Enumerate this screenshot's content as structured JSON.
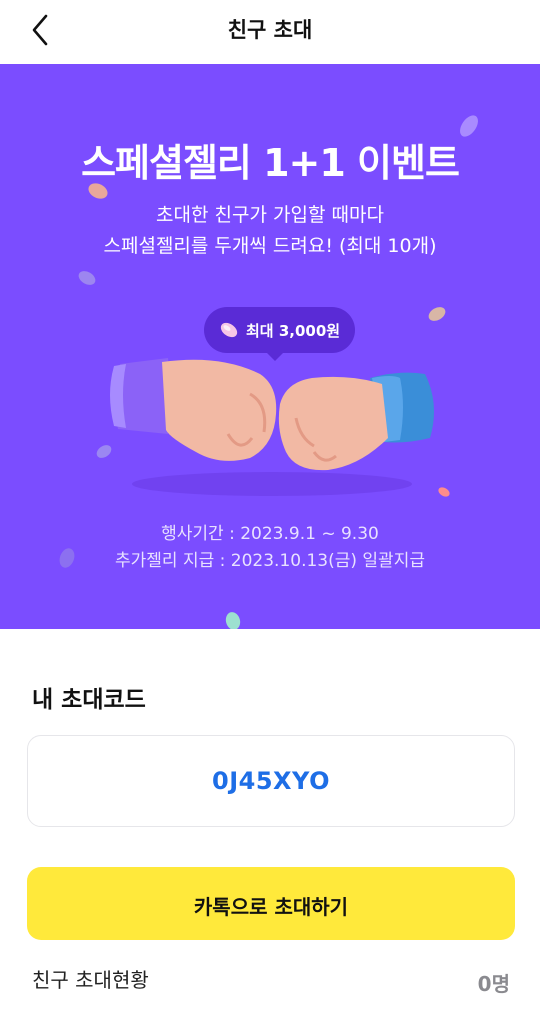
{
  "header": {
    "title": "친구 초대",
    "back_icon": "chevron-left-icon"
  },
  "banner": {
    "background_color": "#7b4dff",
    "title": "스페셜젤리 1+1 이벤트",
    "subtitle_line1": "초대한 친구가 가입할 때마다",
    "subtitle_line2": "스페셜젤리를 두개씩 드려요! (최대 10개)",
    "bubble_text": "최대 3,000원",
    "bubble_icon": "jelly-icon",
    "period_line1": "행사기간 : 2023.9.1 ~ 9.30",
    "period_line2": "추가젤리 지급 : 2023.10.13(금) 일괄지급"
  },
  "invite_code": {
    "section_title": "내 초대코드",
    "code": "0J45XYO",
    "code_color": "#1e6ee6"
  },
  "kakao_button": {
    "label": "카톡으로 초대하기",
    "color": "#ffe93b"
  },
  "invite_status": {
    "label": "친구 초대현황",
    "count": "0명"
  }
}
